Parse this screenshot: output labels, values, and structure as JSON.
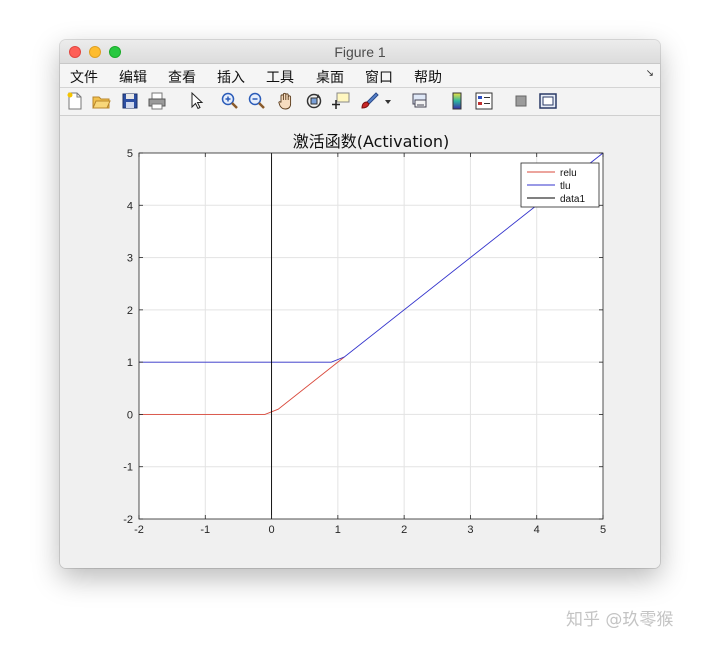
{
  "window": {
    "title": "Figure 1"
  },
  "menu": {
    "items": [
      "文件",
      "编辑",
      "查看",
      "插入",
      "工具",
      "桌面",
      "窗口",
      "帮助"
    ],
    "overflow": "↘"
  },
  "toolbar": {
    "icons": [
      "new-figure-icon",
      "open-file-icon",
      "save-icon",
      "print-icon",
      "pointer-icon",
      "zoom-in-icon",
      "zoom-out-icon",
      "pan-hand-icon",
      "rotate-3d-icon",
      "data-cursor-icon",
      "brush-icon",
      "dropdown-icon",
      "link-plot-icon",
      "colorbar-icon",
      "legend-icon",
      "hide-tools-icon",
      "show-tools-icon"
    ]
  },
  "watermark": "知乎 @玖零猴",
  "chart_data": {
    "type": "line",
    "title": "激活函数(Activation)",
    "xlabel": "",
    "ylabel": "",
    "xlim": [
      -2,
      5
    ],
    "ylim": [
      -2,
      5
    ],
    "xticks": [
      -2,
      -1,
      0,
      1,
      2,
      3,
      4,
      5
    ],
    "yticks": [
      -2,
      -1,
      0,
      1,
      2,
      3,
      4,
      5
    ],
    "grid": true,
    "legend_position": "top-right",
    "series": [
      {
        "name": "relu",
        "color": "#d9483b",
        "x": [
          -2,
          -0.1,
          0.1,
          1.1
        ],
        "y": [
          0,
          0,
          0.1,
          1.1
        ]
      },
      {
        "name": "tlu",
        "color": "#3333cc",
        "x": [
          -2,
          0.9,
          1.1,
          5
        ],
        "y": [
          1,
          1,
          1.1,
          5
        ]
      },
      {
        "name": "data1",
        "color": "#000000",
        "x": [
          0,
          0
        ],
        "y": [
          -2,
          5
        ]
      }
    ]
  }
}
